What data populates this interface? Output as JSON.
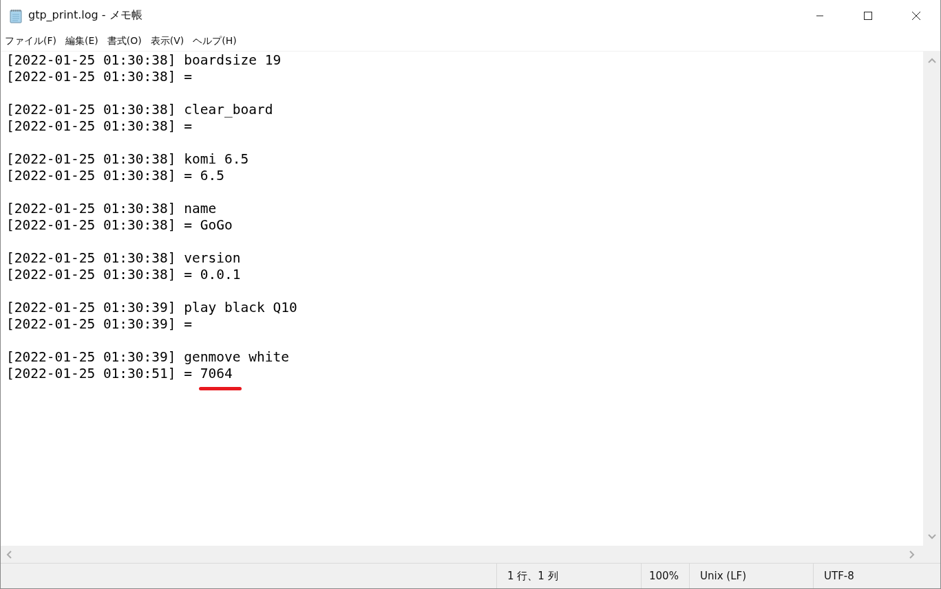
{
  "window": {
    "title": "gtp_print.log - メモ帳"
  },
  "menu": [
    "ファイル(F)",
    "編集(E)",
    "書式(O)",
    "表示(V)",
    "ヘルプ(H)"
  ],
  "log": [
    {
      "lines": [
        {
          "text": "[2022-01-25 01:30:38] boardsize 19"
        },
        {
          "text": "[2022-01-25 01:30:38] ="
        }
      ]
    },
    {
      "lines": [
        {
          "text": "[2022-01-25 01:30:38] clear_board"
        },
        {
          "text": "[2022-01-25 01:30:38] ="
        }
      ]
    },
    {
      "lines": [
        {
          "text": "[2022-01-25 01:30:38] komi 6.5"
        },
        {
          "text": "[2022-01-25 01:30:38] = 6.5"
        }
      ]
    },
    {
      "lines": [
        {
          "text": "[2022-01-25 01:30:38] name"
        },
        {
          "text": "[2022-01-25 01:30:38] = GoGo"
        }
      ]
    },
    {
      "lines": [
        {
          "text": "[2022-01-25 01:30:38] version"
        },
        {
          "text": "[2022-01-25 01:30:38] = 0.0.1"
        }
      ]
    },
    {
      "lines": [
        {
          "text": "[2022-01-25 01:30:39] play black Q10"
        },
        {
          "text": "[2022-01-25 01:30:39] ="
        }
      ]
    },
    {
      "lines": [
        {
          "text": "[2022-01-25 01:30:39] genmove white"
        },
        {
          "text": "[2022-01-25 01:30:51] =",
          "value": "7064",
          "underlined": true
        }
      ]
    }
  ],
  "status_bar": {
    "position": "1 行、1 列",
    "zoom": "100%",
    "line_ending": "Unix (LF)",
    "encoding": "UTF-8"
  }
}
